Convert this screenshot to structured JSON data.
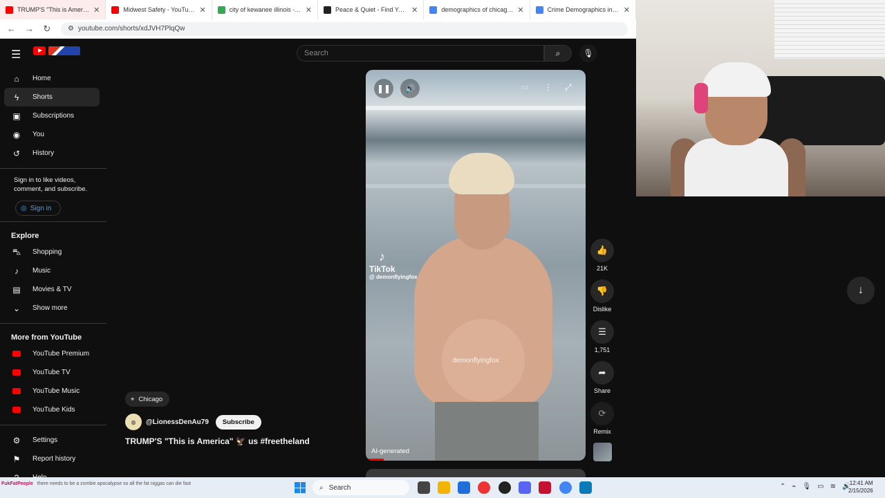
{
  "browser": {
    "tabs": [
      {
        "title": "TRUMP'S \"This is America\"",
        "favicon_color": "#ff0000",
        "active": true
      },
      {
        "title": "Midwest Safety - YouTube",
        "favicon_color": "#ff0000",
        "active": false
      },
      {
        "title": "city of kewanee illinois - Google",
        "favicon_color": "#34a853",
        "active": false
      },
      {
        "title": "Peace & Quiet - Find Your Quiet",
        "favicon_color": "#222222",
        "active": false
      },
      {
        "title": "demographics of chicago - Google",
        "favicon_color": "#4285f4",
        "active": false
      },
      {
        "title": "Crime Demographics in US",
        "favicon_color": "#4285f4",
        "active": false
      }
    ],
    "url": "youtube.com/shorts/xdJVH7PlqQw"
  },
  "header": {
    "search_placeholder": "Search"
  },
  "sidebar": {
    "main": [
      {
        "label": "Home",
        "icon": "home-icon",
        "glyph": "⌂"
      },
      {
        "label": "Shorts",
        "icon": "shorts-icon",
        "glyph": "ϟ",
        "active": true
      },
      {
        "label": "Subscriptions",
        "icon": "subscriptions-icon",
        "glyph": "▣"
      },
      {
        "label": "You",
        "icon": "user-icon",
        "glyph": "◉"
      },
      {
        "label": "History",
        "icon": "history-icon",
        "glyph": "↺"
      }
    ],
    "signin_text": "Sign in to like videos, comment, and subscribe.",
    "signin_label": "Sign in",
    "explore_heading": "Explore",
    "explore": [
      {
        "label": "Shopping",
        "icon": "shopping-icon",
        "glyph": "⛍"
      },
      {
        "label": "Music",
        "icon": "music-icon",
        "glyph": "♪"
      },
      {
        "label": "Movies & TV",
        "icon": "movies-icon",
        "glyph": "▤"
      },
      {
        "label": "Show more",
        "icon": "chevron-down-icon",
        "glyph": "⌄"
      }
    ],
    "more_heading": "More from YouTube",
    "more": [
      {
        "label": "YouTube Premium",
        "icon": "youtube-premium-icon"
      },
      {
        "label": "YouTube TV",
        "icon": "youtube-tv-icon"
      },
      {
        "label": "YouTube Music",
        "icon": "youtube-music-icon"
      },
      {
        "label": "YouTube Kids",
        "icon": "youtube-kids-icon"
      }
    ],
    "bottom": [
      {
        "label": "Settings",
        "icon": "gear-icon",
        "glyph": "⚙"
      },
      {
        "label": "Report history",
        "icon": "flag-icon",
        "glyph": "⚑"
      },
      {
        "label": "Help",
        "icon": "help-icon",
        "glyph": "?"
      }
    ]
  },
  "short": {
    "location": "Chicago",
    "channel": "@LionessDenAu79",
    "subscribe_label": "Subscribe",
    "title": "TRUMP'S \"This is America\"  🦅 us #freetheland",
    "tiktok_brand": "TikTok",
    "tiktok_handle": "@ demonflyingfox",
    "watermark": "demonflyingfox",
    "ai_label": "AI-generated",
    "progress_fraction": 0.07
  },
  "actions": {
    "like_count": "21K",
    "dislike_label": "Dislike",
    "comment_count": "1,751",
    "share_label": "Share",
    "remix_label": "Remix"
  },
  "taskbar": {
    "ticker_name": "FukFatPeople",
    "ticker_text": "there needs to be a zombie apocalypse so all the fat niggas can die fast",
    "search_label": "Search",
    "time": "12:41 AM",
    "date": "2/15/2026"
  }
}
